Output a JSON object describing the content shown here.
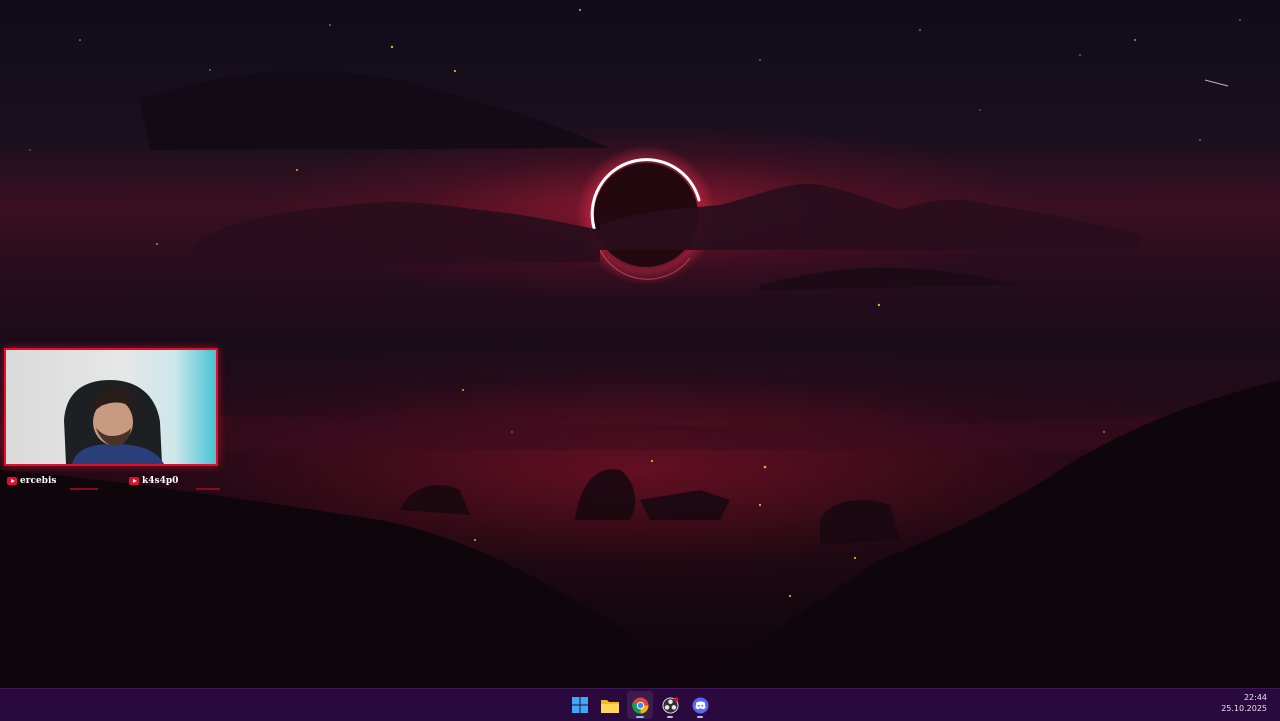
{
  "desktop": {
    "wallpaper": "eclipse-over-crimson-clouds",
    "accent": "#e0102a"
  },
  "webcam_overlay": {
    "border_color": "#e0102a",
    "socials": [
      {
        "icon": "youtube-icon",
        "handle": "ercebis"
      },
      {
        "icon": "youtube-icon",
        "handle": "k4s4p0"
      }
    ]
  },
  "taskbar": {
    "background": "#2a0a3e",
    "apps": [
      {
        "name": "start",
        "icon": "windows-start-icon"
      },
      {
        "name": "file-explorer",
        "icon": "folder-icon"
      },
      {
        "name": "chrome",
        "icon": "chrome-icon"
      },
      {
        "name": "obs-studio",
        "icon": "obs-icon"
      },
      {
        "name": "discord",
        "icon": "discord-icon"
      }
    ],
    "clock": {
      "time": "22:44",
      "date": "25.10.2025"
    }
  }
}
